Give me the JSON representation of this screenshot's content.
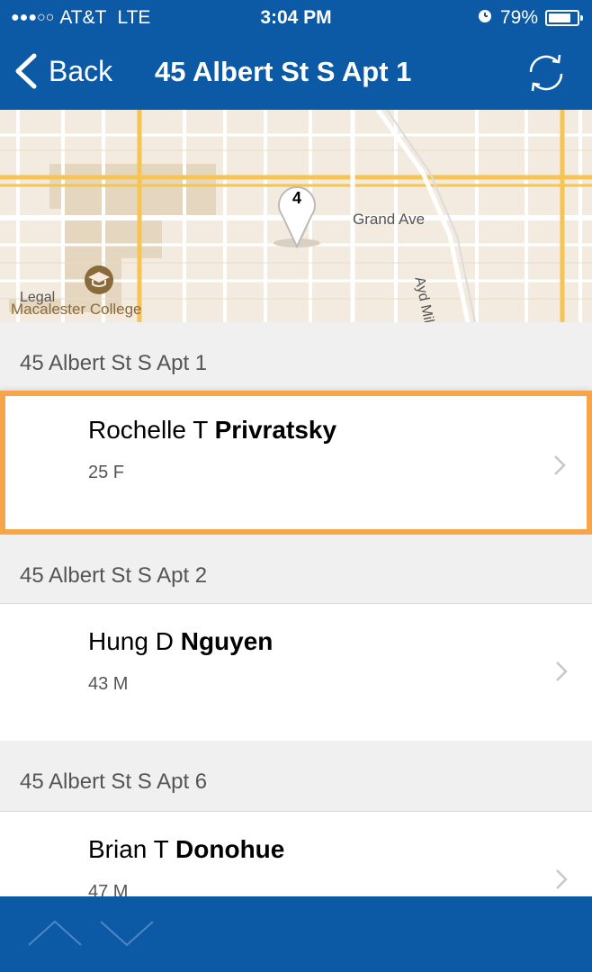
{
  "status_bar": {
    "signal": "●●●○○",
    "carrier": "AT&T",
    "network": "LTE",
    "time": "3:04 PM",
    "alarm_icon": "alarm-clock-icon",
    "battery": "79%",
    "battery_level": 0.79
  },
  "nav": {
    "back_label": "Back",
    "title": "45 Albert St S Apt 1",
    "refresh_icon": "refresh-icon"
  },
  "map": {
    "marker_count": "4",
    "labels": {
      "grand_ave": "Grand Ave",
      "ayd_mill": "Ayd Mill R",
      "legal": "Legal",
      "college": "Macalester College"
    }
  },
  "residences": [
    {
      "address": "45 Albert St S Apt 1",
      "first": "Rochelle T",
      "last": "Privratsky",
      "meta": "25 F"
    },
    {
      "address": "45 Albert St S Apt 2",
      "first": "Hung D",
      "last": "Nguyen",
      "meta": "43 M"
    },
    {
      "address": "45 Albert St S Apt 6",
      "first": "Brian T",
      "last": "Donohue",
      "meta": "47 M"
    }
  ],
  "colors": {
    "brand_blue": "#0c5aa6",
    "highlight_orange": "#f7a54b"
  }
}
